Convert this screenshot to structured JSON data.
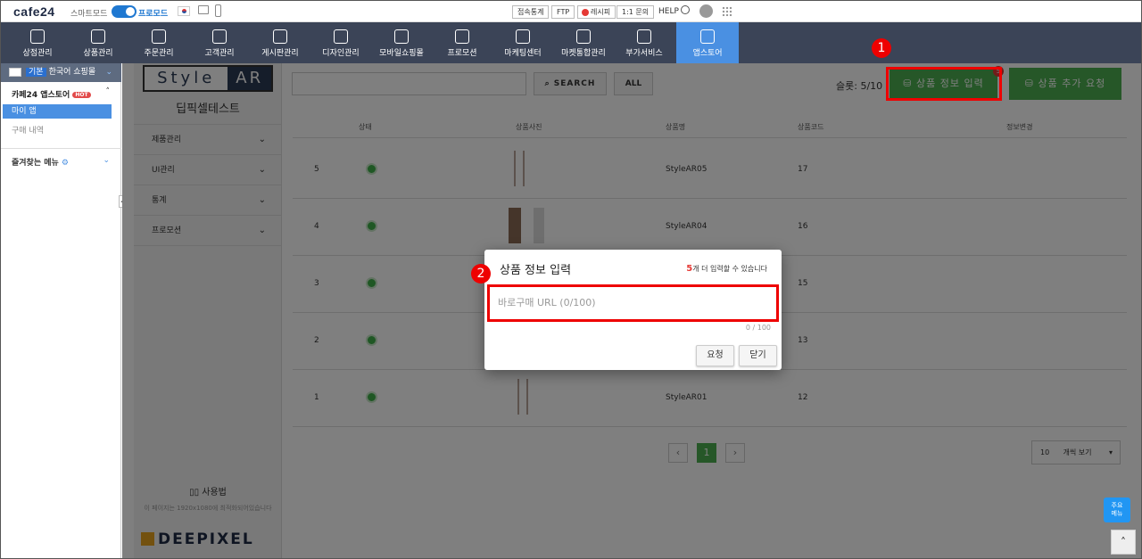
{
  "topbar": {
    "logo": "cafe24",
    "smart_mode": "스마트모드",
    "pro_mode": "프로모드",
    "buttons": [
      "접속통계",
      "FTP",
      "레시피",
      "1:1 문의"
    ],
    "help": "HELP"
  },
  "nav": {
    "items": [
      {
        "label": "상점관리",
        "icon": "home-icon"
      },
      {
        "label": "상품관리",
        "icon": "shirt-icon"
      },
      {
        "label": "주문관리",
        "icon": "cart-icon"
      },
      {
        "label": "고객관리",
        "icon": "users-icon"
      },
      {
        "label": "게시판관리",
        "icon": "board-icon"
      },
      {
        "label": "디자인관리",
        "icon": "palette-icon"
      },
      {
        "label": "모바일쇼핑몰",
        "icon": "mobile-icon"
      },
      {
        "label": "프로모션",
        "icon": "star-icon"
      },
      {
        "label": "마케팅센터",
        "icon": "monitor-icon"
      },
      {
        "label": "마켓통합관리",
        "icon": "network-icon"
      },
      {
        "label": "부가서비스",
        "icon": "plus-folder-icon"
      },
      {
        "label": "앱스토어",
        "icon": "apps-icon"
      }
    ]
  },
  "sidebar": {
    "lang_badge": "기본",
    "lang_label": "한국어 쇼핑몰",
    "store_label": "카페24 앱스토어",
    "hot": "HOT",
    "my_app": "마이 앱",
    "purchase": "구매 내역",
    "favorites": "즐겨찾는 메뉴"
  },
  "left_panel": {
    "logo_style": "Style",
    "logo_ar": "AR",
    "title": "딥픽셀테스트",
    "menu": [
      "제품관리",
      "UI관리",
      "통계",
      "프로모션"
    ],
    "help": "사용법",
    "note": "이 페이지는 1920x1080에 최적화되어있습니다",
    "brand": "DEEPIXEL"
  },
  "toolbar": {
    "search_label": "SEARCH",
    "all_label": "ALL",
    "slot": "슬롯: 5/10",
    "add_info": "상품 정보 입력",
    "add_request": "상품 추가 요청",
    "badge": "5"
  },
  "table": {
    "headers": [
      "상태",
      "상품사진",
      "상품명",
      "상품코드",
      "정보변경"
    ],
    "rows": [
      {
        "no": "5",
        "name": "StyleAR05",
        "code": "17"
      },
      {
        "no": "4",
        "name": "StyleAR04",
        "code": "16"
      },
      {
        "no": "3",
        "name": "",
        "code": "15"
      },
      {
        "no": "2",
        "name": "",
        "code": "13"
      },
      {
        "no": "1",
        "name": "StyleAR01",
        "code": "12"
      }
    ]
  },
  "pager": {
    "current": "1",
    "per_page": "10",
    "per_page_label": "개씩 보기"
  },
  "quick_menu": "주요\n메뉴",
  "modal": {
    "title": "상품 정보 입력",
    "remaining": "5",
    "remaining_text": "개 더 입력할 수 있습니다",
    "placeholder": "바로구매 URL (0/100)",
    "limit": "0 / 100",
    "request": "요청",
    "close": "닫기"
  },
  "annotations": [
    "1",
    "2"
  ],
  "colors": {
    "nav_bg": "#3b4457",
    "active": "#4a90e2",
    "green": "#4caf50",
    "highlight": "#e00000"
  }
}
